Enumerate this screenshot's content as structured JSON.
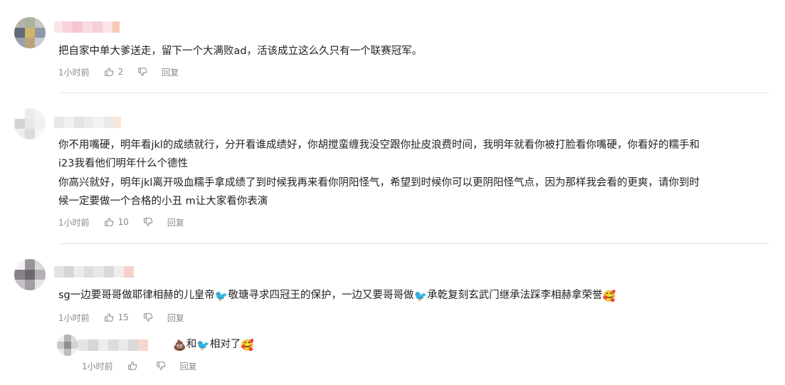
{
  "comments": [
    {
      "text": "把自家中单大爹送走，留下一个大满败ad，活该成立这么久只有一个联赛冠军。",
      "time": "1小时前",
      "likes": "2",
      "reply": "回复"
    },
    {
      "text_line1": "你不用嘴硬，明年看jkl的成绩就行，分开看谁成绩好，你胡搅蛮缠我没空跟你扯皮浪费时间，我明年就看你被打脸看你嘴硬，你看好的糯手和",
      "text_line2": "i23我看他们明年什么个德性",
      "text_line3": "你高兴就好，明年jkl离开吸血糯手拿成绩了到时候我再来看你阴阳怪气，希望到时候你可以更阴阳怪气点，因为那样我会看的更爽，请你到时",
      "text_line4": "候一定要做一个合格的小丑 m让大家看你表演",
      "time": "1小时前",
      "likes": "10",
      "reply": "回复"
    },
    {
      "text_a": "sg一边要哥哥做耶律相赫的儿皇帝",
      "emoji_bird": "🐦",
      "text_b": "敬瑭寻求四冠王的保护，一边又要哥哥做",
      "text_c": "承乾复刻玄武门继承法踩李相赫拿荣誉",
      "emoji_face": "🥰",
      "time": "1小时前",
      "likes": "15",
      "reply": "回复"
    }
  ],
  "sub_reply": {
    "emoji_poop": "💩",
    "text_a": "和",
    "emoji_bird": "🐦",
    "text_b": "相对了",
    "emoji_face": "🥰",
    "time": "1小时前",
    "reply": "回复"
  },
  "icons": {
    "like": "thumbs-up-icon",
    "dislike": "thumbs-down-icon"
  },
  "colors": {
    "text": "#222222",
    "meta": "#8a8a8a",
    "divider": "#e5e5e5",
    "name_blur_pink": "#f8c9cf"
  }
}
